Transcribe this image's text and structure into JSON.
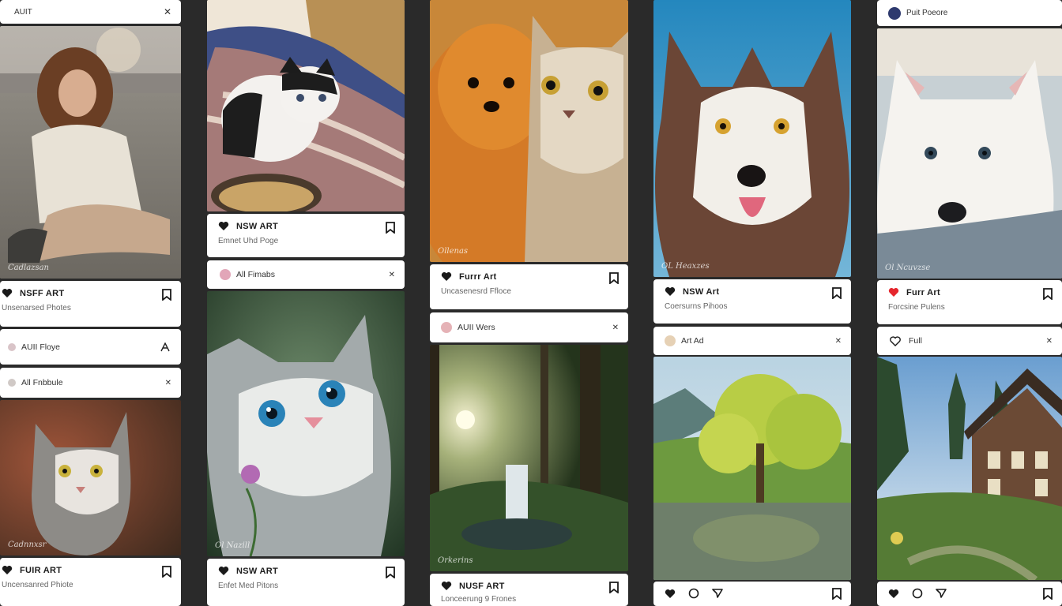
{
  "col1": {
    "top_bar": {
      "label": "AUIT"
    },
    "card1": {
      "title": "NSFF ART",
      "subtitle": "Unsenarsed Photes",
      "signature": "Cadlazsan"
    },
    "bar_a": {
      "label": "AUII Floye"
    },
    "bar_b": {
      "label": "All Fnbbule"
    },
    "card2": {
      "title": "FUIR ART",
      "subtitle": "Uncensanred Phiote",
      "signature": "Cadnnxsr"
    }
  },
  "col2": {
    "card1": {
      "title": "NSW ART",
      "subtitle": "Emnet Uhd Poge"
    },
    "bar_a": {
      "label": "All Fimabs"
    },
    "card2": {
      "title": "NSW ART",
      "subtitle": "Enfet Med Pitons",
      "signature": "Ol Nazill"
    }
  },
  "col3": {
    "card1": {
      "title": "Furrr Art",
      "subtitle": "Uncasenesrd Ffloce",
      "signature": "Ollenas"
    },
    "bar_a": {
      "label": "AUII Wers"
    },
    "card2": {
      "title": "NUSF ART",
      "subtitle": "Lonceerung 9 Frones",
      "signature": "Orkerins"
    }
  },
  "col4": {
    "card1": {
      "title": "NSW Art",
      "subtitle": "Coersurns Pihoos",
      "signature": "OL Heaxzes"
    },
    "bar_a": {
      "label": "Art Ad"
    }
  },
  "col5": {
    "top_bar": {
      "label": "Puit Poeore"
    },
    "card1": {
      "title": "Furr Art",
      "subtitle": "Forcsine Pulens",
      "signature": "Ol Ncuvzse"
    },
    "bar_a": {
      "label": "Full"
    }
  },
  "colors": {
    "background": "#2a2a2a",
    "card": "#ffffff",
    "heart_red": "#e5262d",
    "heart_dark": "#1a1a1a"
  },
  "icons": [
    "heart-icon",
    "bookmark-icon",
    "close-icon",
    "share-icon",
    "comment-icon",
    "send-icon",
    "avatar-icon"
  ]
}
